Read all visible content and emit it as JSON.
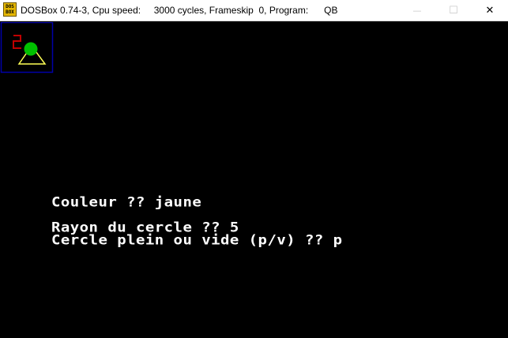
{
  "window": {
    "icon_text_top": "DOS",
    "icon_text_bottom": "BOX",
    "title": "DOSBox 0.74-3, Cpu speed:     3000 cycles, Frameskip  0, Program:      QB",
    "minimize_glyph": "—",
    "maximize_glyph": "☐",
    "close_glyph": "✕"
  },
  "screen": {
    "colors": {
      "background": "#000000",
      "box_border": "#0000a8",
      "red_shape": "#c00000",
      "green_circle": "#00c000",
      "yellow_triangle": "#ffff55"
    },
    "lines": [
      "Couleur ?? jaune",
      "Rayon du cercle ?? 5",
      "Cercle plein ou vide (p/v) ?? p"
    ]
  }
}
